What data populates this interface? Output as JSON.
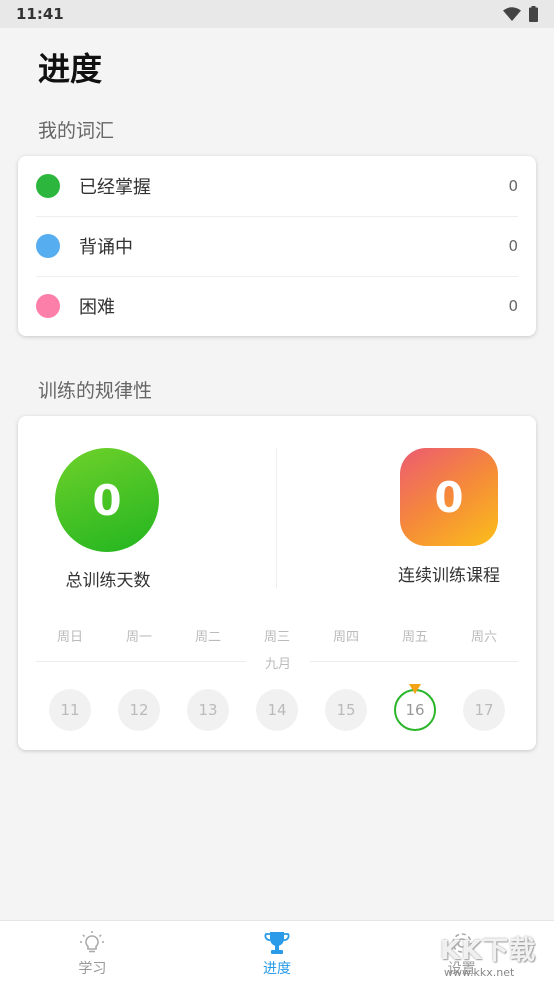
{
  "status_bar": {
    "time": "11:41",
    "wifi_icon": "wifi-icon",
    "battery_icon": "battery-icon"
  },
  "page_title": "进度",
  "vocabulary": {
    "title": "我的词汇",
    "items": [
      {
        "label": "已经掌握",
        "count": "0",
        "color": "#2db63d"
      },
      {
        "label": "背诵中",
        "count": "0",
        "color": "#56adf0"
      },
      {
        "label": "困难",
        "count": "0",
        "color": "#fb7fa8"
      }
    ]
  },
  "training": {
    "title": "训练的规律性",
    "total_days": {
      "value": "0",
      "label": "总训练天数"
    },
    "streak": {
      "value": "0",
      "label": "连续训练课程"
    },
    "weekdays": [
      "周日",
      "周一",
      "周二",
      "周三",
      "周四",
      "周五",
      "周六"
    ],
    "month": "九月",
    "dates": [
      "11",
      "12",
      "13",
      "14",
      "15",
      "16",
      "17"
    ],
    "today": "16"
  },
  "bottom_nav": [
    {
      "label": "学习",
      "icon": "lightbulb-icon",
      "active": false
    },
    {
      "label": "进度",
      "icon": "trophy-icon",
      "active": true
    },
    {
      "label": "设置",
      "icon": "gear-icon",
      "active": false
    }
  ],
  "watermark": {
    "logo": "KK下载",
    "url": "www.kkx.net"
  },
  "colors": {
    "accent": "#2a9be8",
    "today_ring": "#2bb52a",
    "today_marker": "#f4a316"
  }
}
